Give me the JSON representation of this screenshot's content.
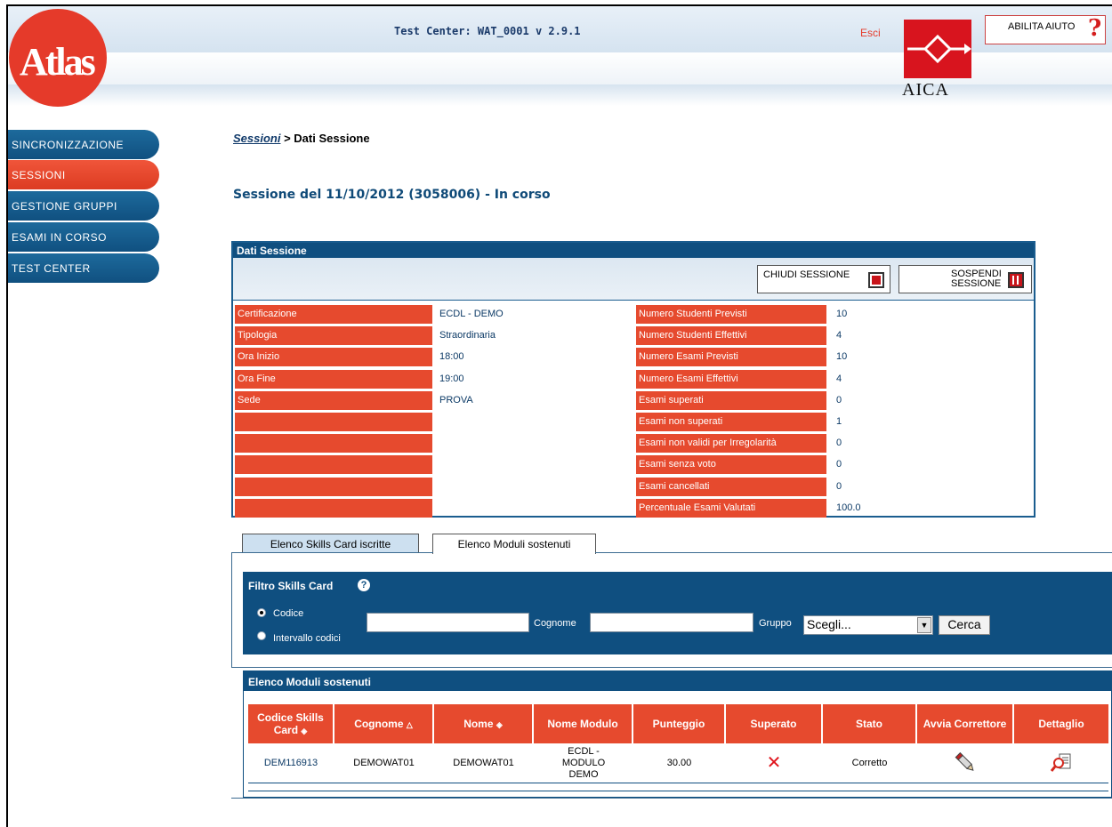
{
  "header": {
    "logo_text": "Atlas",
    "app_title": "Test Center: WAT_0001 v 2.9.1",
    "exit_label": "Esci",
    "aica_label": "AICA",
    "help_label": "ABILITA AIUTO",
    "help_glyph": "?"
  },
  "sidebar": {
    "items": [
      {
        "label": "SINCRONIZZAZIONE",
        "active": false
      },
      {
        "label": "SESSIONI",
        "active": true
      },
      {
        "label": "GESTIONE GRUPPI",
        "active": false
      },
      {
        "label": "ESAMI IN CORSO",
        "active": false
      },
      {
        "label": "TEST CENTER",
        "active": false
      }
    ]
  },
  "breadcrumb": {
    "link": "Sessioni",
    "separator": " > ",
    "current": "Dati Sessione"
  },
  "session_title": "Sessione del 11/10/2012 (3058006) - In corso",
  "panel": {
    "title": "Dati Sessione",
    "close_label": "CHIUDI SESSIONE",
    "suspend_label_1": "SOSPENDI",
    "suspend_label_2": "SESSIONE",
    "left_rows": [
      {
        "label": "Certificazione",
        "value": "ECDL - DEMO"
      },
      {
        "label": "Tipologia",
        "value": "Straordinaria"
      },
      {
        "label": "Ora Inizio",
        "value": "18:00"
      },
      {
        "label": "Ora Fine",
        "value": "19:00"
      },
      {
        "label": "Sede",
        "value": "PROVA"
      },
      {
        "label": "",
        "value": ""
      },
      {
        "label": "",
        "value": ""
      },
      {
        "label": "",
        "value": ""
      },
      {
        "label": "",
        "value": ""
      },
      {
        "label": "",
        "value": ""
      }
    ],
    "right_rows": [
      {
        "label": "Numero Studenti Previsti",
        "value": "10"
      },
      {
        "label": "Numero Studenti Effettivi",
        "value": "4"
      },
      {
        "label": "Numero Esami Previsti",
        "value": "10"
      },
      {
        "label": "Numero Esami Effettivi",
        "value": "4"
      },
      {
        "label": "Esami superati",
        "value": "0"
      },
      {
        "label": "Esami non superati",
        "value": "1"
      },
      {
        "label": "Esami non validi per Irregolarità",
        "value": "0"
      },
      {
        "label": "Esami senza voto",
        "value": "0"
      },
      {
        "label": "Esami cancellati",
        "value": "0"
      },
      {
        "label": "Percentuale Esami Valutati",
        "value": "100.0"
      }
    ]
  },
  "tabs": [
    {
      "label": "Elenco Skills Card iscritte",
      "active": false
    },
    {
      "label": "Elenco Moduli sostenuti",
      "active": true
    }
  ],
  "filter": {
    "title": "Filtro Skills Card",
    "help_glyph": "?",
    "radio_code": "Codice",
    "radio_range": "Intervallo codici",
    "selected_radio": "Codice",
    "code_value": "",
    "surname_label": "Cognome",
    "surname_value": "",
    "group_label": "Gruppo",
    "group_selected": "Scegli...",
    "search_button": "Cerca"
  },
  "results": {
    "title": "Elenco Moduli sostenuti",
    "columns": [
      "Codice Skills Card",
      "Cognome",
      "Nome",
      "Nome Modulo",
      "Punteggio",
      "Superato",
      "Stato",
      "Avvia Correttore",
      "Dettaglio"
    ],
    "sort_glyphs": {
      "Codice Skills Card": "◈",
      "Cognome": "△",
      "Nome": "◈"
    },
    "rows": [
      {
        "code": "DEM116913",
        "surname": "DEMOWAT01",
        "name": "DEMOWAT01",
        "module": "ECDL - MODULO DEMO",
        "score": "30.00",
        "passed": "✕",
        "state": "Corretto",
        "start_icon": "pencil-icon",
        "detail_icon": "magnifier-document-icon"
      }
    ]
  },
  "colors": {
    "accent_red": "#e64a2e",
    "dark_blue": "#0f4f80",
    "logo_red": "#e53a2a",
    "aica_red": "#d8141e"
  }
}
